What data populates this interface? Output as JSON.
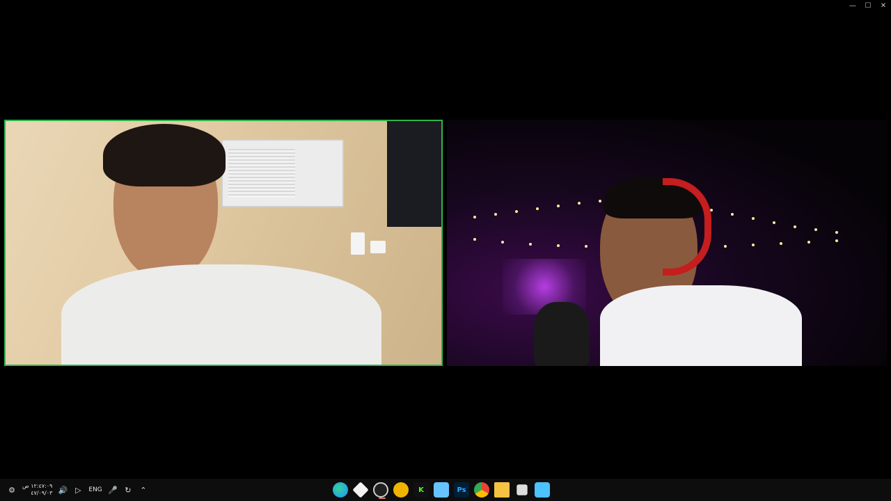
{
  "window": {
    "controls": [
      {
        "name": "minimize",
        "glyph": "—"
      },
      {
        "name": "maximize",
        "glyph": "☐"
      },
      {
        "name": "close",
        "glyph": "✕"
      }
    ]
  },
  "call": {
    "participants": [
      {
        "id": "left",
        "active_speaker": true,
        "border_color": "#2db54a"
      },
      {
        "id": "right",
        "active_speaker": false
      }
    ]
  },
  "taskbar": {
    "clock": {
      "time": "١٢:٤٧:٠٩ ص",
      "date": "٤٧/٠٩/٠٣"
    },
    "language": "ENG",
    "tray_icons": [
      "notification-icon",
      "volume-icon",
      "network-icon",
      "microphone-icon",
      "sync-icon",
      "chevron-up-icon"
    ],
    "apps": [
      {
        "name": "edge-icon",
        "label": "",
        "color": "#1e90ff"
      },
      {
        "name": "game-app-icon",
        "label": "",
        "color": "#ffffff"
      },
      {
        "name": "obs-icon",
        "label": "",
        "color": "#cfcfcf",
        "active": true
      },
      {
        "name": "discord-icon",
        "label": "",
        "color": "#f0b400"
      },
      {
        "name": "kick-icon",
        "label": "K",
        "color": "#53fc18"
      },
      {
        "name": "notepad-icon",
        "label": "",
        "color": "#66c3ff"
      },
      {
        "name": "photoshop-icon",
        "label": "Ps",
        "color": "#31a8ff"
      },
      {
        "name": "chrome-icon",
        "label": "",
        "color": "#fbbc05"
      },
      {
        "name": "file-explorer-icon",
        "label": "",
        "color": "#f5c242"
      },
      {
        "name": "task-view-icon",
        "label": "",
        "color": "#dddddd"
      },
      {
        "name": "start-icon",
        "label": "",
        "color": "#4cc2ff"
      }
    ]
  }
}
